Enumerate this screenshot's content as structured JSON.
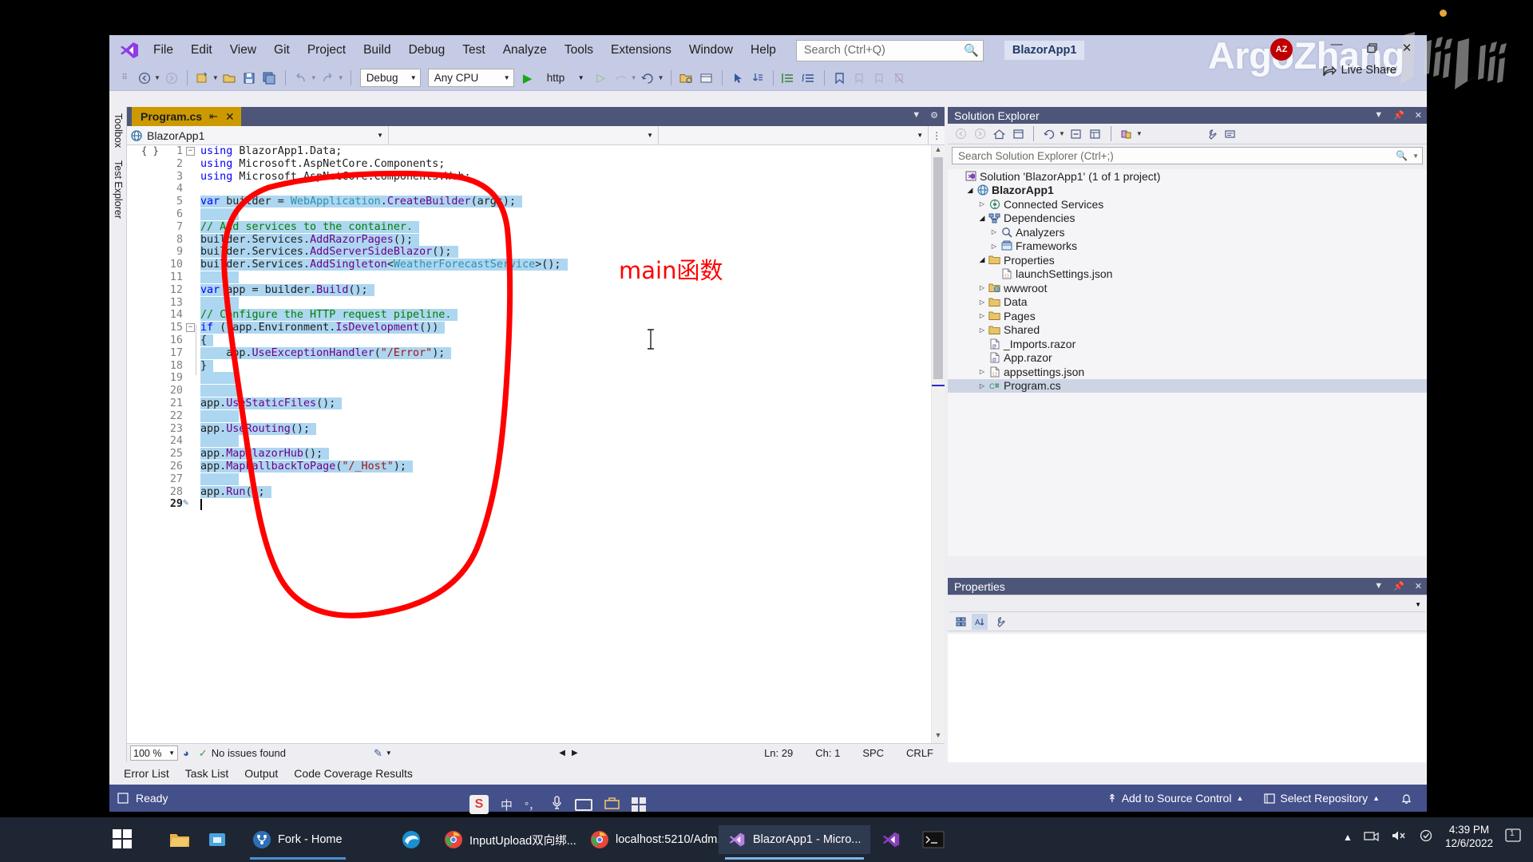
{
  "window": {
    "project_pill": "BlazorApp1",
    "watermark": "ArgoZhang",
    "avatar_initials": "AZ",
    "live_share": "Live Share",
    "minimize": "—",
    "restore": "❐",
    "close": "✕"
  },
  "menu": {
    "items": [
      {
        "label": "File"
      },
      {
        "label": "Edit"
      },
      {
        "label": "View"
      },
      {
        "label": "Git"
      },
      {
        "label": "Project"
      },
      {
        "label": "Build"
      },
      {
        "label": "Debug"
      },
      {
        "label": "Test"
      },
      {
        "label": "Analyze"
      },
      {
        "label": "Tools"
      },
      {
        "label": "Extensions"
      },
      {
        "label": "Window"
      },
      {
        "label": "Help"
      }
    ]
  },
  "search": {
    "placeholder": "Search (Ctrl+Q)",
    "icon": "search-icon"
  },
  "toolbar": {
    "config": "Debug",
    "platform": "Any CPU",
    "run_target": "http",
    "run_icon": "play-icon"
  },
  "left_rail": {
    "toolbox": "Toolbox",
    "test_explorer": "Test Explorer"
  },
  "document": {
    "tab_title": "Program.cs",
    "pin_glyph": "⇥",
    "close_glyph": "✕",
    "nav_project": "BlazorApp1",
    "nav_type": "",
    "nav_member": ""
  },
  "code": {
    "lines": [
      {
        "n": "1",
        "fold": "−",
        "sel": false,
        "tokens": [
          {
            "t": "using ",
            "c": "k"
          },
          {
            "t": "BlazorApp1.Data;",
            "c": "p"
          }
        ]
      },
      {
        "n": "2",
        "sel": false,
        "tokens": [
          {
            "t": "using ",
            "c": "k"
          },
          {
            "t": "Microsoft.AspNetCore.Components;",
            "c": "p"
          }
        ]
      },
      {
        "n": "3",
        "sel": false,
        "tokens": [
          {
            "t": "using ",
            "c": "k"
          },
          {
            "t": "Microsoft.AspNetCore.Components.Web;",
            "c": "p"
          }
        ]
      },
      {
        "n": "4",
        "sel": false,
        "tokens": []
      },
      {
        "n": "5",
        "sel": true,
        "tokens": [
          {
            "t": "var",
            "c": "k"
          },
          {
            "t": " builder = ",
            "c": "p"
          },
          {
            "t": "WebApplication",
            "c": "t"
          },
          {
            "t": ".",
            "c": "p"
          },
          {
            "t": "CreateBuilder",
            "c": "m"
          },
          {
            "t": "(args);",
            "c": "p"
          }
        ]
      },
      {
        "n": "6",
        "sel": true,
        "tokens": []
      },
      {
        "n": "7",
        "sel": true,
        "tokens": [
          {
            "t": "// Add services to the container.",
            "c": "c"
          }
        ]
      },
      {
        "n": "8",
        "sel": true,
        "tokens": [
          {
            "t": "builder.Services.",
            "c": "p"
          },
          {
            "t": "AddRazorPages",
            "c": "m"
          },
          {
            "t": "();",
            "c": "p"
          }
        ]
      },
      {
        "n": "9",
        "sel": true,
        "tokens": [
          {
            "t": "builder.Services.",
            "c": "p"
          },
          {
            "t": "AddServerSideBlazor",
            "c": "m"
          },
          {
            "t": "();",
            "c": "p"
          }
        ]
      },
      {
        "n": "10",
        "sel": true,
        "tokens": [
          {
            "t": "builder.Services.",
            "c": "p"
          },
          {
            "t": "AddSingleton",
            "c": "m"
          },
          {
            "t": "<",
            "c": "p"
          },
          {
            "t": "WeatherForecastService",
            "c": "t"
          },
          {
            "t": ">();",
            "c": "p"
          }
        ]
      },
      {
        "n": "11",
        "sel": true,
        "tokens": []
      },
      {
        "n": "12",
        "sel": true,
        "tokens": [
          {
            "t": "var",
            "c": "k"
          },
          {
            "t": " app = builder.",
            "c": "p"
          },
          {
            "t": "Build",
            "c": "m"
          },
          {
            "t": "();",
            "c": "p"
          }
        ]
      },
      {
        "n": "13",
        "sel": true,
        "tokens": []
      },
      {
        "n": "14",
        "sel": true,
        "tokens": [
          {
            "t": "// Configure the HTTP request pipeline.",
            "c": "c"
          }
        ]
      },
      {
        "n": "15",
        "fold": "−",
        "sel": true,
        "tokens": [
          {
            "t": "if",
            "c": "k"
          },
          {
            "t": " (!app.",
            "c": "p"
          },
          {
            "t": "Environment",
            "c": "p"
          },
          {
            "t": ".",
            "c": "p"
          },
          {
            "t": "IsDevelopment",
            "c": "m"
          },
          {
            "t": "())",
            "c": "p"
          }
        ]
      },
      {
        "n": "16",
        "sel": true,
        "tokens": [
          {
            "t": "{",
            "c": "p"
          }
        ]
      },
      {
        "n": "17",
        "sel": true,
        "tokens": [
          {
            "t": "    app.",
            "c": "p"
          },
          {
            "t": "UseExceptionHandler",
            "c": "m"
          },
          {
            "t": "(",
            "c": "p"
          },
          {
            "t": "\"/Error\"",
            "c": "s"
          },
          {
            "t": ");",
            "c": "p"
          }
        ]
      },
      {
        "n": "18",
        "sel": true,
        "tokens": [
          {
            "t": "}",
            "c": "p"
          }
        ]
      },
      {
        "n": "19",
        "sel": true,
        "tokens": []
      },
      {
        "n": "20",
        "sel": true,
        "tokens": []
      },
      {
        "n": "21",
        "sel": true,
        "tokens": [
          {
            "t": "app.",
            "c": "p"
          },
          {
            "t": "UseStaticFiles",
            "c": "m"
          },
          {
            "t": "();",
            "c": "p"
          }
        ]
      },
      {
        "n": "22",
        "sel": true,
        "tokens": []
      },
      {
        "n": "23",
        "sel": true,
        "tokens": [
          {
            "t": "app.",
            "c": "p"
          },
          {
            "t": "UseRouting",
            "c": "m"
          },
          {
            "t": "();",
            "c": "p"
          }
        ]
      },
      {
        "n": "24",
        "sel": true,
        "tokens": []
      },
      {
        "n": "25",
        "sel": true,
        "tokens": [
          {
            "t": "app.",
            "c": "p"
          },
          {
            "t": "MapBlazorHub",
            "c": "m"
          },
          {
            "t": "();",
            "c": "p"
          }
        ]
      },
      {
        "n": "26",
        "sel": true,
        "tokens": [
          {
            "t": "app.",
            "c": "p"
          },
          {
            "t": "MapFallbackToPage",
            "c": "m"
          },
          {
            "t": "(",
            "c": "p"
          },
          {
            "t": "\"/_Host\"",
            "c": "s"
          },
          {
            "t": ");",
            "c": "p"
          }
        ]
      },
      {
        "n": "27",
        "sel": true,
        "tokens": []
      },
      {
        "n": "28",
        "sel": true,
        "tokens": [
          {
            "t": "app.",
            "c": "p"
          },
          {
            "t": "Run",
            "c": "m"
          },
          {
            "t": "();",
            "c": "p"
          }
        ]
      },
      {
        "n": "29",
        "sel": false,
        "tokens": []
      }
    ]
  },
  "editor_status": {
    "zoom": "100 %",
    "issues": "No issues found",
    "line": "Ln: 29",
    "col": "Ch: 1",
    "spaces": "SPC",
    "eol": "CRLF"
  },
  "solution_explorer": {
    "title": "Solution Explorer",
    "search_placeholder": "Search Solution Explorer (Ctrl+;)",
    "root": "Solution 'BlazorApp1' (1 of 1 project)",
    "tree": [
      {
        "depth": 0,
        "arrow": "",
        "icon": "solution-icon",
        "label": "Solution 'BlazorApp1' (1 of 1 project)",
        "selected": false
      },
      {
        "depth": 1,
        "arrow": "▲",
        "icon": "project-web-icon",
        "label": "BlazorApp1",
        "selected": false,
        "bold": true
      },
      {
        "depth": 2,
        "arrow": "▶",
        "icon": "connected-services-icon",
        "label": "Connected Services",
        "selected": false
      },
      {
        "depth": 2,
        "arrow": "▲",
        "icon": "dependencies-icon",
        "label": "Dependencies",
        "selected": false
      },
      {
        "depth": 3,
        "arrow": "▶",
        "icon": "analyzers-icon",
        "label": "Analyzers",
        "selected": false
      },
      {
        "depth": 3,
        "arrow": "▶",
        "icon": "frameworks-icon",
        "label": "Frameworks",
        "selected": false
      },
      {
        "depth": 2,
        "arrow": "▲",
        "icon": "folder-icon",
        "label": "Properties",
        "selected": false
      },
      {
        "depth": 3,
        "arrow": "",
        "icon": "json-file-icon",
        "label": "launchSettings.json",
        "selected": false
      },
      {
        "depth": 2,
        "arrow": "▶",
        "icon": "wwwroot-icon",
        "label": "wwwroot",
        "selected": false
      },
      {
        "depth": 2,
        "arrow": "▶",
        "icon": "folder-icon",
        "label": "Data",
        "selected": false
      },
      {
        "depth": 2,
        "arrow": "▶",
        "icon": "folder-icon",
        "label": "Pages",
        "selected": false
      },
      {
        "depth": 2,
        "arrow": "▶",
        "icon": "folder-icon",
        "label": "Shared",
        "selected": false
      },
      {
        "depth": 2,
        "arrow": "",
        "icon": "razor-file-icon",
        "label": "_Imports.razor",
        "selected": false
      },
      {
        "depth": 2,
        "arrow": "",
        "icon": "razor-file-icon",
        "label": "App.razor",
        "selected": false
      },
      {
        "depth": 2,
        "arrow": "▶",
        "icon": "json-file-icon",
        "label": "appsettings.json",
        "selected": false
      },
      {
        "depth": 2,
        "arrow": "▶",
        "icon": "csharp-file-icon",
        "label": "Program.cs",
        "selected": true
      }
    ]
  },
  "properties_panel": {
    "title": "Properties"
  },
  "bottom_tabs": [
    {
      "label": "Error List"
    },
    {
      "label": "Task List"
    },
    {
      "label": "Output"
    },
    {
      "label": "Code Coverage Results"
    }
  ],
  "status_bar": {
    "ready": "Ready",
    "add_to_source_control": "Add to Source Control",
    "select_repository": "Select Repository",
    "bell_icon": "bell-icon"
  },
  "annotation": {
    "label": "main函数",
    "color": "#FF0000"
  },
  "ime": {
    "lang": "中",
    "punct": "°，",
    "mic": "mic-icon",
    "keyboard": "keyboard-icon",
    "toolbox": "toolbox-icon",
    "grid": "grid-icon",
    "logo": "S"
  },
  "taskbar": {
    "items": [
      {
        "label": "",
        "icon": "file-explorer-icon",
        "color": "#E8B14A",
        "active": false
      },
      {
        "label": "",
        "icon": "store-icon",
        "color": "#4AA3DF",
        "active": false
      },
      {
        "label": "Fork - Home",
        "icon": "fork-icon",
        "color": "#2D6FB4",
        "active": false
      },
      {
        "label": "",
        "icon": "edge-icon",
        "color": "#1B8FD1",
        "active": false
      },
      {
        "label": "InputUpload双向绑...",
        "icon": "chrome-icon",
        "color": "#E8453C",
        "active": false
      },
      {
        "label": "localhost:5210/Adm...",
        "icon": "chrome-icon",
        "color": "#E8453C",
        "active": false
      },
      {
        "label": "BlazorApp1 - Micro...",
        "icon": "vs-icon",
        "color": "#8B3FBF",
        "active": true
      },
      {
        "label": "",
        "icon": "vs-icon",
        "color": "#8B3FBF",
        "active": false
      },
      {
        "label": "",
        "icon": "terminal-icon",
        "color": "#111111",
        "active": false
      }
    ],
    "clock_time": "4:39 PM",
    "clock_date": "12/6/2022",
    "notification_count": "1"
  }
}
